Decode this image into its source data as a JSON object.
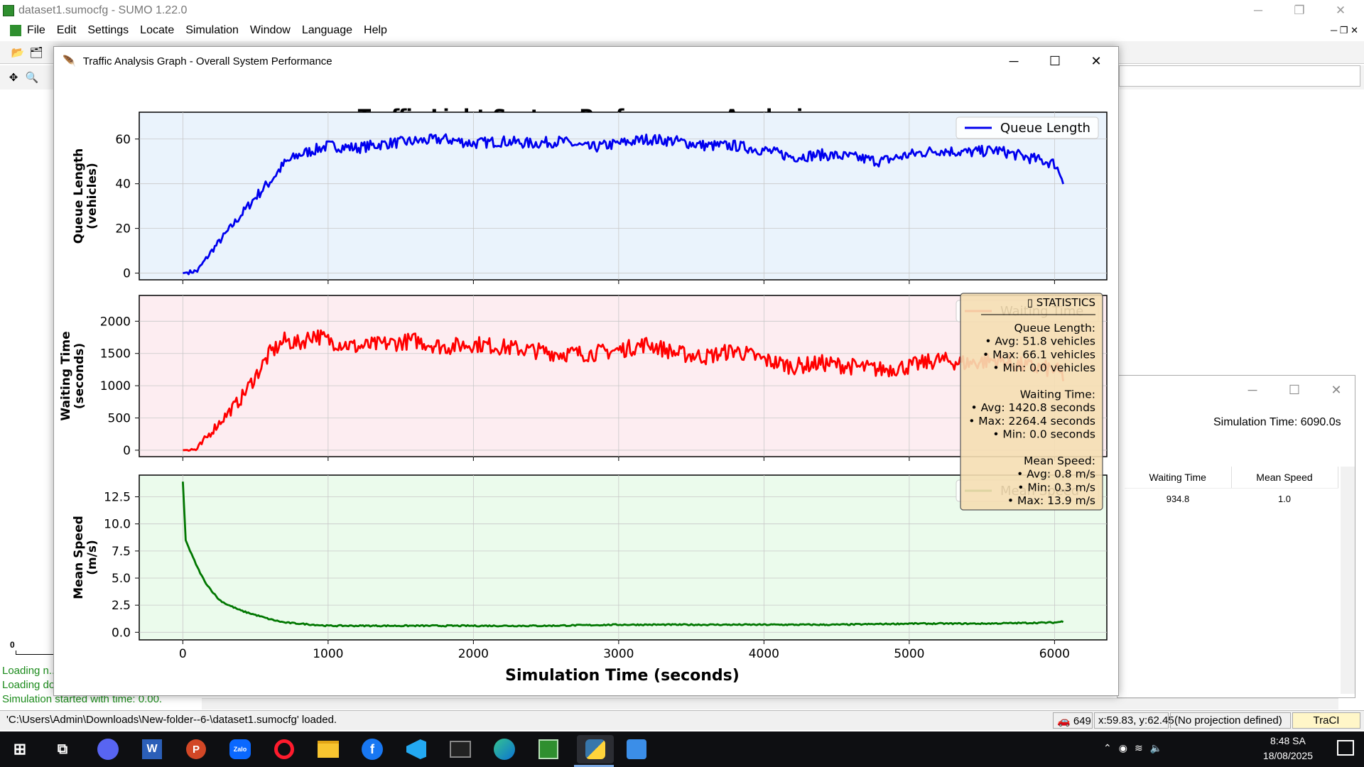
{
  "sumo": {
    "title": "dataset1.sumocfg - SUMO 1.22.0",
    "menu": [
      "File",
      "Edit",
      "Settings",
      "Locate",
      "Simulation",
      "Window",
      "Language",
      "Help"
    ],
    "messages": [
      "Loading n...",
      "Loading do...",
      "Simulation started with time: 0.00."
    ],
    "canvas_label": "0",
    "status": {
      "file": "'C:\\Users\\Admin\\Downloads\\New-folder--6-\\dataset1.sumocfg' loaded.",
      "vehicles": "649",
      "coords": "x:59.83, y:62.45",
      "projection": "(No projection defined)",
      "traci": "TraCI"
    }
  },
  "secondary_window": {
    "sim_time": "Simulation Time: 6090.0s",
    "columns": [
      "Waiting Time",
      "Mean Speed"
    ],
    "row": [
      "934.8",
      "1.0"
    ]
  },
  "graph_window": {
    "title": "Traffic Analysis Graph - Overall System Performance"
  },
  "taskbar": {
    "time": "8:48 SA",
    "date": "18/08/2025",
    "apps": [
      "discord-icon",
      "word-icon",
      "powerpoint-icon",
      "zalo-icon",
      "opera-icon",
      "file-explorer-icon",
      "facebook-icon",
      "vscode-icon",
      "terminal-icon",
      "edge-icon",
      "sumo-icon",
      "python-icon",
      "photos-icon"
    ]
  },
  "chart_data": {
    "type": "line",
    "title": "Traffic Light System Performance Analysis",
    "xlabel": "Simulation Time (seconds)",
    "xlim": [
      -300,
      6360
    ],
    "xticks": [
      0,
      1000,
      2000,
      3000,
      4000,
      5000,
      6000
    ],
    "panels": [
      {
        "name": "Queue Length",
        "ylabel_lines": [
          "Queue Length",
          "(vehicles)"
        ],
        "color": "#0000ee",
        "bg": "#eaf3fc",
        "ylim": [
          -3,
          72
        ],
        "yticks": [
          0,
          20,
          40,
          60
        ],
        "ytick_labels": [
          "0",
          "20",
          "40",
          "60"
        ],
        "legend": "Queue Length",
        "x": [
          0,
          100,
          200,
          300,
          400,
          500,
          600,
          700,
          800,
          900,
          1000,
          1200,
          1400,
          1600,
          1800,
          2000,
          2200,
          2400,
          2600,
          2800,
          3000,
          3200,
          3400,
          3600,
          3800,
          4000,
          4200,
          4400,
          4600,
          4800,
          5000,
          5200,
          5400,
          5600,
          5800,
          6000,
          6060
        ],
        "y": [
          0,
          1,
          10,
          18,
          26,
          34,
          41,
          49,
          53,
          55,
          57,
          56,
          58,
          59,
          60,
          58,
          59,
          58,
          59,
          56,
          58,
          60,
          59,
          57,
          57,
          55,
          52,
          53,
          52,
          50,
          53,
          55,
          54,
          55,
          52,
          49,
          42
        ]
      },
      {
        "name": "Waiting Time",
        "ylabel_lines": [
          "Waiting Time",
          "(seconds)"
        ],
        "color": "#ff0000",
        "bg": "#fdedf1",
        "ylim": [
          -100,
          2400
        ],
        "yticks": [
          0,
          500,
          1000,
          1500,
          2000
        ],
        "ytick_labels": [
          "0",
          "500",
          "1000",
          "1500",
          "2000"
        ],
        "legend": "Waiting Time",
        "x": [
          0,
          100,
          200,
          300,
          400,
          500,
          600,
          700,
          800,
          900,
          1000,
          1200,
          1400,
          1600,
          1800,
          2000,
          2200,
          2400,
          2600,
          2800,
          3000,
          3200,
          3400,
          3600,
          3800,
          4000,
          4200,
          4400,
          4600,
          4800,
          5000,
          5200,
          5400,
          5600,
          5800,
          6000,
          6060
        ],
        "y": [
          0,
          10,
          300,
          550,
          800,
          1150,
          1500,
          1700,
          1650,
          1800,
          1700,
          1600,
          1650,
          1700,
          1600,
          1650,
          1600,
          1550,
          1500,
          1500,
          1550,
          1650,
          1500,
          1450,
          1550,
          1400,
          1300,
          1350,
          1300,
          1250,
          1300,
          1400,
          1350,
          1400,
          1300,
          1250,
          1150
        ]
      },
      {
        "name": "Mean Speed",
        "ylabel_lines": [
          "Mean Speed",
          "(m/s)"
        ],
        "color": "#007700",
        "bg": "#ebfbec",
        "ylim": [
          -0.7,
          14.5
        ],
        "yticks": [
          0,
          2.5,
          5,
          7.5,
          10,
          12.5
        ],
        "ytick_labels": [
          "0.0",
          "2.5",
          "5.0",
          "7.5",
          "10.0",
          "12.5"
        ],
        "legend": "Mean Speed",
        "x": [
          0,
          20,
          50,
          100,
          150,
          200,
          250,
          300,
          400,
          500,
          600,
          700,
          800,
          1000,
          1500,
          2000,
          2500,
          3000,
          3500,
          4000,
          4500,
          5000,
          5500,
          6000,
          6060
        ],
        "y": [
          13.9,
          8.5,
          7.5,
          6.0,
          4.7,
          3.8,
          3.0,
          2.6,
          2.0,
          1.6,
          1.2,
          0.9,
          0.8,
          0.6,
          0.6,
          0.6,
          0.6,
          0.7,
          0.7,
          0.7,
          0.7,
          0.8,
          0.8,
          0.9,
          1.0
        ]
      }
    ],
    "stats_box": {
      "header": "STATISTICS",
      "lines": [
        "Queue Length:",
        "• Avg: 51.8 vehicles",
        "• Max: 66.1 vehicles",
        "• Min: 0.0 vehicles",
        "",
        "Waiting Time:",
        "• Avg: 1420.8 seconds",
        "• Max: 2264.4 seconds",
        "• Min: 0.0 seconds",
        "",
        "Mean Speed:",
        "• Avg: 0.8 m/s",
        "• Min: 0.3 m/s",
        "• Max: 13.9 m/s"
      ]
    }
  }
}
